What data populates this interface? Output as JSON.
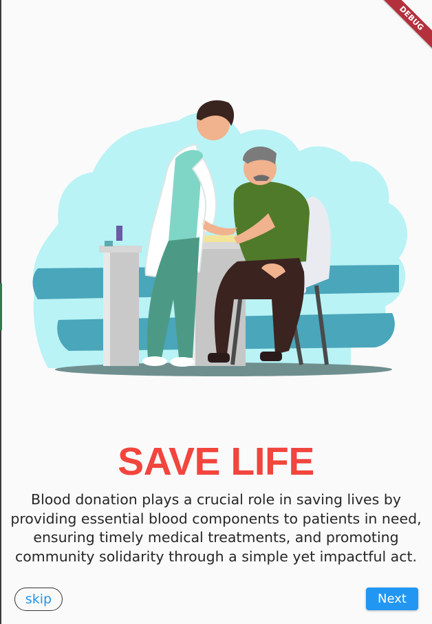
{
  "debug_banner": {
    "label": "DEBUG"
  },
  "onboarding": {
    "title": "SAVE LIFE",
    "description": "Blood donation plays a crucial role in saving lives by providing essential blood components to patients in need, ensuring timely medical treatments, and promoting community solidarity through a simple yet impactful act.",
    "skip_label": "skip",
    "next_label": "Next"
  },
  "colors": {
    "title": "#f1453d",
    "primary": "#2196f3",
    "background": "#fafafa",
    "debug_ribbon": "#b3303c"
  }
}
